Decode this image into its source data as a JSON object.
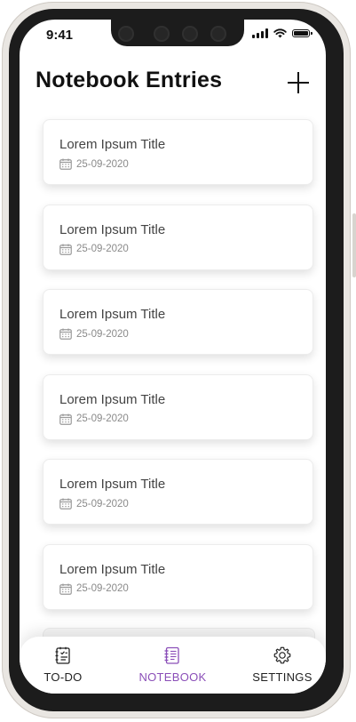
{
  "status_bar": {
    "time": "9:41"
  },
  "header": {
    "title": "Notebook Entries"
  },
  "entries": [
    {
      "title": "Lorem Ipsum Title",
      "date": "25-09-2020"
    },
    {
      "title": "Lorem Ipsum Title",
      "date": "25-09-2020"
    },
    {
      "title": "Lorem Ipsum Title",
      "date": "25-09-2020"
    },
    {
      "title": "Lorem Ipsum Title",
      "date": "25-09-2020"
    },
    {
      "title": "Lorem Ipsum Title",
      "date": "25-09-2020"
    },
    {
      "title": "Lorem Ipsum Title",
      "date": "25-09-2020"
    }
  ],
  "tabs": [
    {
      "label": "TO-DO",
      "icon": "todo-icon"
    },
    {
      "label": "NOTEBOOK",
      "icon": "notebook-icon",
      "active": true
    },
    {
      "label": "SETTINGS",
      "icon": "gear-icon"
    }
  ],
  "colors": {
    "accent": "#8b4fb8",
    "text": "#111111",
    "muted": "#8a8a8a"
  }
}
